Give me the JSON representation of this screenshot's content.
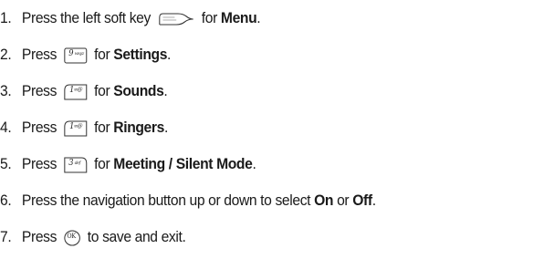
{
  "steps": [
    {
      "number": "1.",
      "pre": "Press the left soft key",
      "key": {
        "icon": "soft-key-icon",
        "label": ""
      },
      "post": "for",
      "bold": "Menu",
      "end": "."
    },
    {
      "number": "2.",
      "pre": "Press",
      "key": {
        "icon": "key-9-icon",
        "label": "9",
        "sub": "wxyz"
      },
      "post": "for",
      "bold": "Settings",
      "end": "."
    },
    {
      "number": "3.",
      "pre": "Press",
      "key": {
        "icon": "key-1-icon",
        "label": "1",
        "sub": "∞@"
      },
      "post": "for",
      "bold": "Sounds",
      "end": "."
    },
    {
      "number": "4.",
      "pre": "Press",
      "key": {
        "icon": "key-1-icon",
        "label": "1",
        "sub": "∞@"
      },
      "post": "for",
      "bold": "Ringers",
      "end": "."
    },
    {
      "number": "5.",
      "pre": "Press",
      "key": {
        "icon": "key-3-icon",
        "label": "3",
        "sub": "def"
      },
      "post": "for",
      "bold": "Meeting / Silent Mode",
      "end": "."
    },
    {
      "number": "6.",
      "text1": "Press the navigation button up or down to select",
      "bold1": "On",
      "text2": "or",
      "bold2": "Off",
      "end": "."
    },
    {
      "number": "7.",
      "pre": "Press",
      "key": {
        "icon": "ok-key-icon",
        "label": "OK"
      },
      "post": "to save and exit."
    }
  ]
}
